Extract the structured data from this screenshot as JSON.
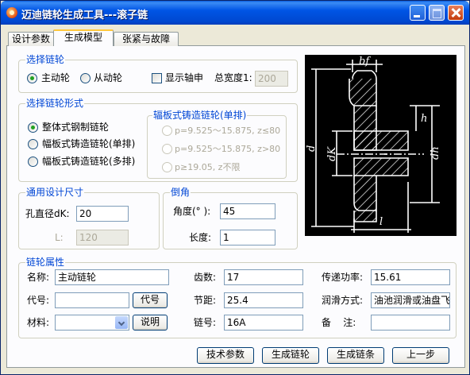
{
  "window": {
    "title": "迈迪链轮生成工具---滚子链"
  },
  "tabs": [
    {
      "label": "设计参数",
      "active": false
    },
    {
      "label": "生成模型",
      "active": true
    },
    {
      "label": "张紧与故障",
      "active": false
    }
  ],
  "select_sprocket": {
    "title": "选择链轮",
    "driving": "主动轮",
    "driven": "从动轮",
    "selected": "driving",
    "show_shaft_ext": "显示轴申",
    "total_width_label": "总宽度1:",
    "total_width_value": "200"
  },
  "sprocket_form": {
    "title": "选择链轮形式",
    "options": [
      "整体式钢制链轮",
      "幅板式铸造链轮(单排)",
      "幅板式铸造链轮(多排)"
    ],
    "selected": 0,
    "cast_group": {
      "title": "辐板式铸造链轮(单排)",
      "options": [
        "p=9.525～15.875, z≤80",
        "p=9.525～15.875, z>80",
        "p≥19.05, z不限"
      ]
    }
  },
  "general_dims": {
    "title": "通用设计尺寸",
    "bore_label": "孔直径dK:",
    "bore_value": "20",
    "l_label": "L:",
    "l_value": "120"
  },
  "chamfer": {
    "title": "倒角",
    "angle_label": "角度(° ):",
    "angle_value": "45",
    "length_label": "长度:",
    "length_value": "1"
  },
  "diagram_labels": {
    "bf": "bf",
    "h": "h",
    "d": "d",
    "dk": "dK",
    "dh": "dh",
    "l": "l"
  },
  "properties": {
    "title": "链轮属性",
    "name_label": "名称:",
    "name_value": "主动链轮",
    "code_label": "代号:",
    "code_value": "",
    "code_button": "代号",
    "material_label": "材料:",
    "material_value": "",
    "material_button": "说明",
    "teeth_label": "齿数:",
    "teeth_value": "17",
    "pitch_label": "节距:",
    "pitch_value": "25.4",
    "chain_no_label": "链号:",
    "chain_no_value": "16A",
    "power_label": "传递功率:",
    "power_value": "15.61",
    "lube_label": "润滑方式:",
    "lube_value": "油池润滑或油盘飞",
    "remark_label": "备    注:",
    "remark_value": ""
  },
  "buttons": {
    "tech_params": "技术参数",
    "gen_sprocket": "生成链轮",
    "gen_chain": "生成链条",
    "prev_step": "上一步"
  }
}
